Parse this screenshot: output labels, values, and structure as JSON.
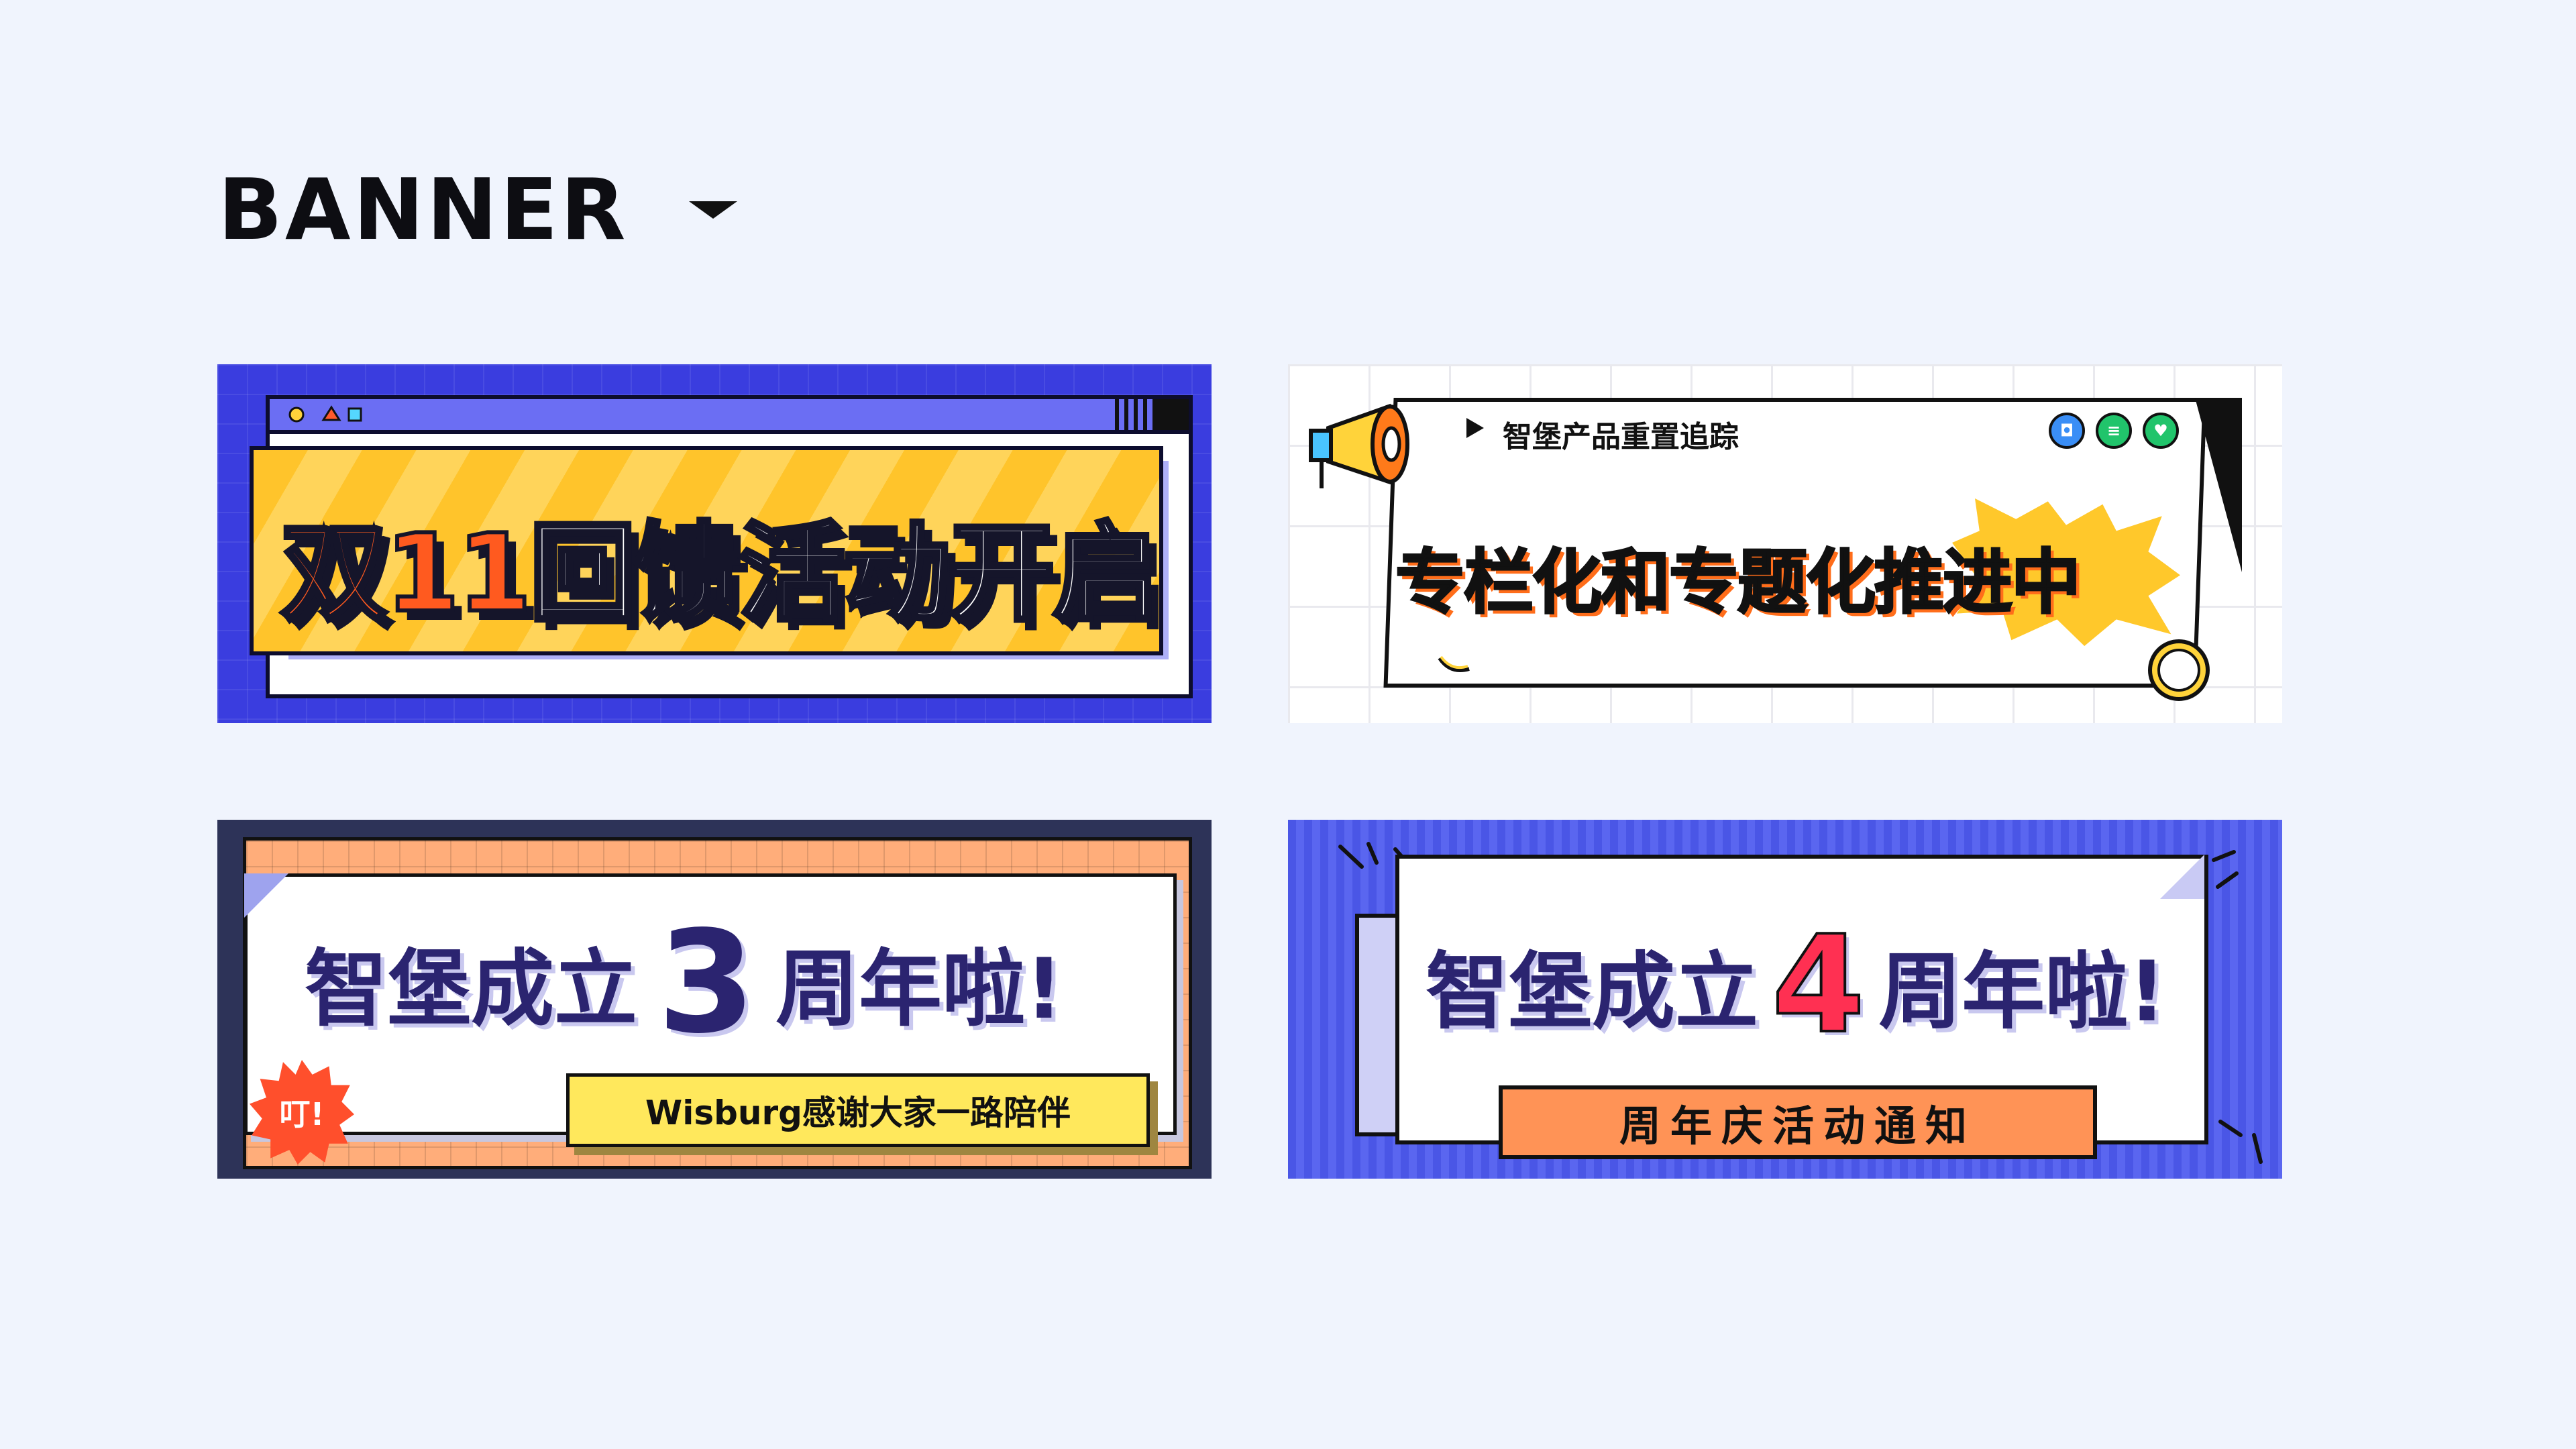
{
  "header": {
    "title": "BANNER"
  },
  "banners": {
    "b1": {
      "prefix": "双11",
      "rest": "回馈活动开启"
    },
    "b2": {
      "subtitle": "智堡产品重置追踪",
      "main": "专栏化和专题化推进中"
    },
    "b3": {
      "left": "智堡成立",
      "num": "3",
      "right": "周年啦!",
      "ribbon": "Wisburg感谢大家一路陪伴",
      "badge": "叮!"
    },
    "b4": {
      "left": "智堡成立",
      "num": "4",
      "right": "周年啦!",
      "ribbon": "周年庆活动通知"
    }
  },
  "colors": {
    "background": "#f0f4fd",
    "blue": "#3a3ddf",
    "yellow": "#ffc42b",
    "orange": "#ff5a1f",
    "navy": "#2b2470",
    "red": "#ff3052"
  }
}
